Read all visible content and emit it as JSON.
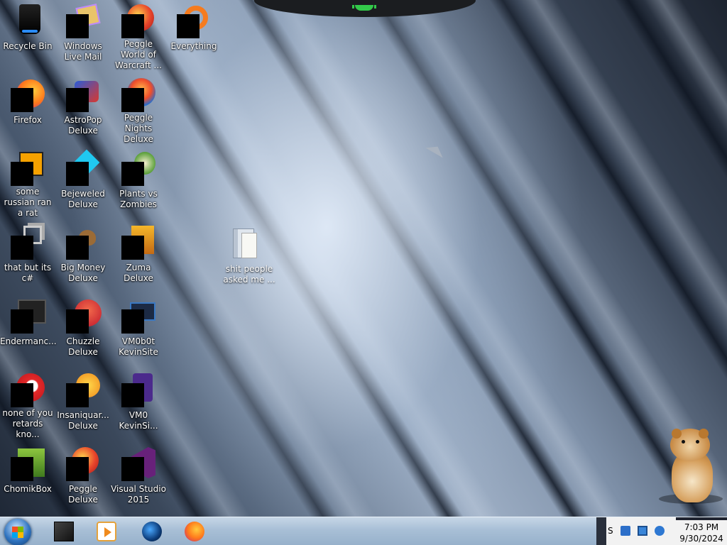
{
  "desktop": {
    "icons": [
      {
        "label": "Recycle Bin",
        "icon": "recycle-bin-icon"
      },
      {
        "label": "Windows Live Mail",
        "icon": "mail-icon"
      },
      {
        "label": "Peggle World of Warcraft ...",
        "icon": "peggle-icon"
      },
      {
        "label": "Everything",
        "icon": "search-ring-icon"
      },
      {
        "label": "Firefox",
        "icon": "firefox-icon"
      },
      {
        "label": "AstroPop Deluxe",
        "icon": "astropop-icon"
      },
      {
        "label": "Peggle Nights Deluxe",
        "icon": "peggle-nights-icon"
      },
      {
        "label": "some russian ran a rat",
        "icon": "file-icon"
      },
      {
        "label": "Bejeweled Deluxe",
        "icon": "gem-icon"
      },
      {
        "label": "Plants vs Zombies",
        "icon": "flower-icon"
      },
      {
        "label": "that but its c#",
        "icon": "stack-icon"
      },
      {
        "label": "Big Money Deluxe",
        "icon": "money-bag-icon"
      },
      {
        "label": "Zuma Deluxe",
        "icon": "zuma-icon"
      },
      {
        "label": "Endermanc...",
        "icon": "console-icon"
      },
      {
        "label": "Chuzzle Deluxe",
        "icon": "chuzzle-icon"
      },
      {
        "label": "VM0b0t KevinSite",
        "icon": "monitor-icon"
      },
      {
        "label": "none of you retards kno...",
        "icon": "ring-icon"
      },
      {
        "label": "Insaniquar... Deluxe",
        "icon": "fish-icon"
      },
      {
        "label": "VM0 KevinSi...",
        "icon": "purple-app-icon"
      },
      {
        "label": "ChomikBox",
        "icon": "chomikbox-icon"
      },
      {
        "label": "Peggle Deluxe",
        "icon": "peggle-deluxe-icon"
      },
      {
        "label": "Visual Studio 2015",
        "icon": "visual-studio-icon"
      }
    ],
    "folder": {
      "label": "shit people asked me ...",
      "icon": "folder-icon"
    }
  },
  "taskbar": {
    "start": "windows-start-icon",
    "pinned": [
      {
        "name": "cube-app-icon"
      },
      {
        "name": "media-player-icon"
      },
      {
        "name": "globe-app-icon"
      },
      {
        "name": "firefox-icon"
      }
    ],
    "tray": {
      "overflow_glyph": "S",
      "time": "7:03 PM",
      "date": "9/30/2024"
    }
  }
}
